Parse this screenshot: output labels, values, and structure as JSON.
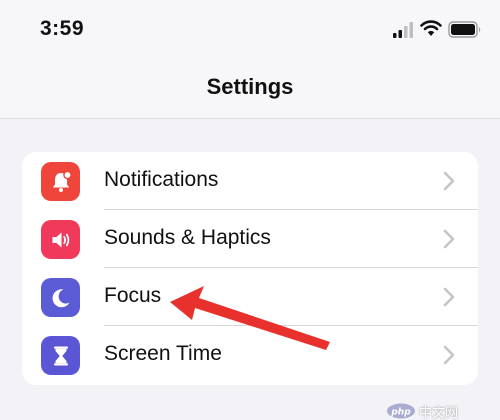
{
  "status_bar": {
    "time": "3:59",
    "icons": [
      "cellular-signal-icon",
      "wifi-icon",
      "battery-icon"
    ]
  },
  "nav": {
    "title": "Settings"
  },
  "settings_items": [
    {
      "label": "Notifications",
      "icon": "bell-badge-icon",
      "icon_color": "#f0453a"
    },
    {
      "label": "Sounds & Haptics",
      "icon": "speaker-wave-icon",
      "icon_color": "#f0395b"
    },
    {
      "label": "Focus",
      "icon": "crescent-moon-icon",
      "icon_color": "#5b5bd6"
    },
    {
      "label": "Screen Time",
      "icon": "hourglass-icon",
      "icon_color": "#5b56d6"
    }
  ],
  "annotation": {
    "arrow_color": "#e8312c",
    "points_to": "Focus"
  },
  "watermark": {
    "text": "中文网"
  },
  "colors": {
    "background": "#f2f2f7",
    "separator": "#d6d6db",
    "chevron": "#c4c4c9"
  }
}
